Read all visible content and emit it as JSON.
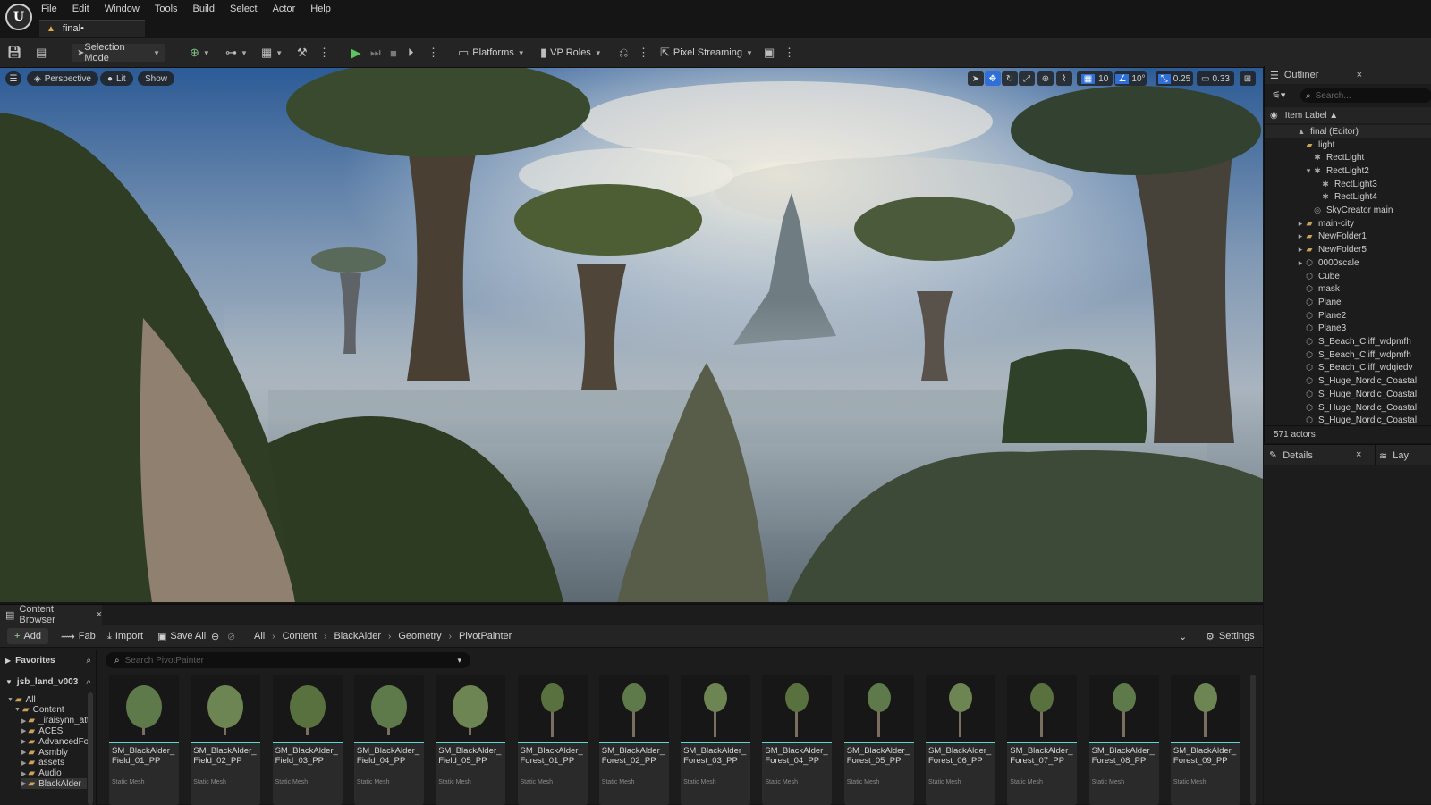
{
  "menu": [
    "File",
    "Edit",
    "Window",
    "Tools",
    "Build",
    "Select",
    "Actor",
    "Help"
  ],
  "document_tab": "final•",
  "toolbar": {
    "selection_mode": "Selection Mode",
    "platforms": "Platforms",
    "vp_roles": "VP Roles",
    "pixel_streaming": "Pixel Streaming"
  },
  "viewport": {
    "perspective": "Perspective",
    "lit": "Lit",
    "show": "Show",
    "grid_snap": "10",
    "rot_snap": "10°",
    "scale_snap": "0.25",
    "camera_speed": "0.33"
  },
  "outliner": {
    "title": "Outliner",
    "search_placeholder": "Search...",
    "column": "Item Label ▲",
    "items": [
      {
        "label": "final (Editor)",
        "icon": "level-icon",
        "indent": 3
      },
      {
        "label": "light",
        "icon": "folder-icon",
        "indent": 4
      },
      {
        "label": "RectLight",
        "icon": "light-icon",
        "indent": 5
      },
      {
        "label": "RectLight2",
        "icon": "light-icon",
        "indent": 5
      },
      {
        "label": "RectLight3",
        "icon": "light-icon",
        "indent": 6
      },
      {
        "label": "RectLight4",
        "icon": "light-icon",
        "indent": 6
      },
      {
        "label": "SkyCreator main",
        "icon": "actor-icon",
        "indent": 5
      },
      {
        "label": "main-city",
        "icon": "folder-icon",
        "indent": 4
      },
      {
        "label": "NewFolder1",
        "icon": "folder-icon",
        "indent": 4
      },
      {
        "label": "NewFolder5",
        "icon": "folder-icon",
        "indent": 4
      },
      {
        "label": "0000scale",
        "icon": "mesh-icon",
        "indent": 4
      },
      {
        "label": "Cube",
        "icon": "mesh-icon",
        "indent": 4
      },
      {
        "label": "mask",
        "icon": "mesh-icon",
        "indent": 4
      },
      {
        "label": "Plane",
        "icon": "mesh-icon",
        "indent": 4
      },
      {
        "label": "Plane2",
        "icon": "mesh-icon",
        "indent": 4
      },
      {
        "label": "Plane3",
        "icon": "mesh-icon",
        "indent": 4
      },
      {
        "label": "S_Beach_Cliff_wdpmfh",
        "icon": "mesh-icon",
        "indent": 4
      },
      {
        "label": "S_Beach_Cliff_wdpmfh",
        "icon": "mesh-icon",
        "indent": 4
      },
      {
        "label": "S_Beach_Cliff_wdqiedv",
        "icon": "mesh-icon",
        "indent": 4
      },
      {
        "label": "S_Huge_Nordic_Coastal",
        "icon": "mesh-icon",
        "indent": 4
      },
      {
        "label": "S_Huge_Nordic_Coastal",
        "icon": "mesh-icon",
        "indent": 4
      },
      {
        "label": "S_Huge_Nordic_Coastal",
        "icon": "mesh-icon",
        "indent": 4
      },
      {
        "label": "S_Huge_Nordic_Coastal",
        "icon": "mesh-icon",
        "indent": 4
      }
    ],
    "count": "571 actors"
  },
  "details": {
    "title": "Details",
    "layers": "Lay"
  },
  "content_browser": {
    "tab": "Content Browser",
    "add": "Add",
    "fab": "Fab",
    "import": "Import",
    "save_all": "Save All",
    "breadcrumb": [
      "All",
      "Content",
      "BlackAlder",
      "Geometry",
      "PivotPainter"
    ],
    "settings": "Settings",
    "favorites": "Favorites",
    "project": "jsb_land_v003",
    "search_placeholder": "Search PivotPainter",
    "tree": [
      {
        "label": "All",
        "indent": 0
      },
      {
        "label": "Content",
        "indent": 1
      },
      {
        "label": "_iraisynn_att",
        "indent": 2
      },
      {
        "label": "ACES",
        "indent": 2
      },
      {
        "label": "AdvancedFo",
        "indent": 2
      },
      {
        "label": "Asmbly",
        "indent": 2
      },
      {
        "label": "assets",
        "indent": 2
      },
      {
        "label": "Audio",
        "indent": 2
      },
      {
        "label": "BlackAlder",
        "indent": 2
      }
    ],
    "assets": [
      {
        "name": "SM_BlackAlder_ Field_01_PP",
        "type": "Static Mesh"
      },
      {
        "name": "SM_BlackAlder_ Field_02_PP",
        "type": "Static Mesh"
      },
      {
        "name": "SM_BlackAlder_ Field_03_PP",
        "type": "Static Mesh"
      },
      {
        "name": "SM_BlackAlder_ Field_04_PP",
        "type": "Static Mesh"
      },
      {
        "name": "SM_BlackAlder_ Field_05_PP",
        "type": "Static Mesh"
      },
      {
        "name": "SM_BlackAlder_ Forest_01_PP",
        "type": "Static Mesh"
      },
      {
        "name": "SM_BlackAlder_ Forest_02_PP",
        "type": "Static Mesh"
      },
      {
        "name": "SM_BlackAlder_ Forest_03_PP",
        "type": "Static Mesh"
      },
      {
        "name": "SM_BlackAlder_ Forest_04_PP",
        "type": "Static Mesh"
      },
      {
        "name": "SM_BlackAlder_ Forest_05_PP",
        "type": "Static Mesh"
      },
      {
        "name": "SM_BlackAlder_ Forest_06_PP",
        "type": "Static Mesh"
      },
      {
        "name": "SM_BlackAlder_ Forest_07_PP",
        "type": "Static Mesh"
      },
      {
        "name": "SM_BlackAlder_ Forest_08_PP",
        "type": "Static Mesh"
      },
      {
        "name": "SM_BlackAlder_ Forest_09_PP",
        "type": "Static Mesh"
      }
    ]
  },
  "colors": {
    "accent": "#5bd8d0",
    "play": "#5ec25e",
    "folder": "#c9a35a",
    "active_tool": "#2f6fd6"
  }
}
